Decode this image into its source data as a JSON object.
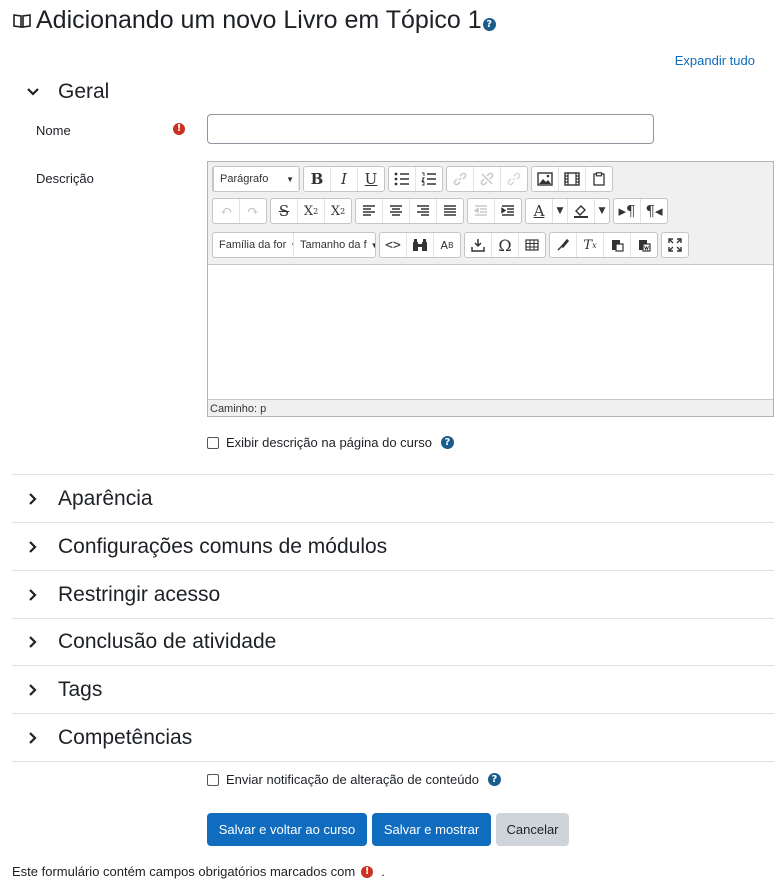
{
  "header": {
    "title": "Adicionando um novo Livro em Tópico 1",
    "expand_all": "Expandir tudo"
  },
  "sections": {
    "general": "Geral",
    "collapsed": [
      "Aparência",
      "Configurações comuns de módulos",
      "Restringir acesso",
      "Conclusão de atividade",
      "Tags",
      "Competências"
    ]
  },
  "form": {
    "name_label": "Nome",
    "name_value": "",
    "description_label": "Descrição",
    "show_description": "Exibir descrição na página do curso",
    "notify_change": "Enviar notificação de alteração de conteúdo"
  },
  "editor": {
    "format_select": "Parágrafo",
    "font_family_select": "Família da for",
    "font_size_select": "Tamanho da f",
    "path": "Caminho: p"
  },
  "buttons": {
    "save_return": "Salvar e voltar ao curso",
    "save_display": "Salvar e mostrar",
    "cancel": "Cancelar"
  },
  "footer": {
    "required_note": "Este formulário contém campos obrigatórios marcados com",
    "period": "."
  },
  "icons": {
    "help": "?",
    "required": "!"
  },
  "colors": {
    "accent": "#0f6cbf",
    "help": "#1a5c8c",
    "required": "#ca3120",
    "secondary_button": "#ced4da"
  }
}
